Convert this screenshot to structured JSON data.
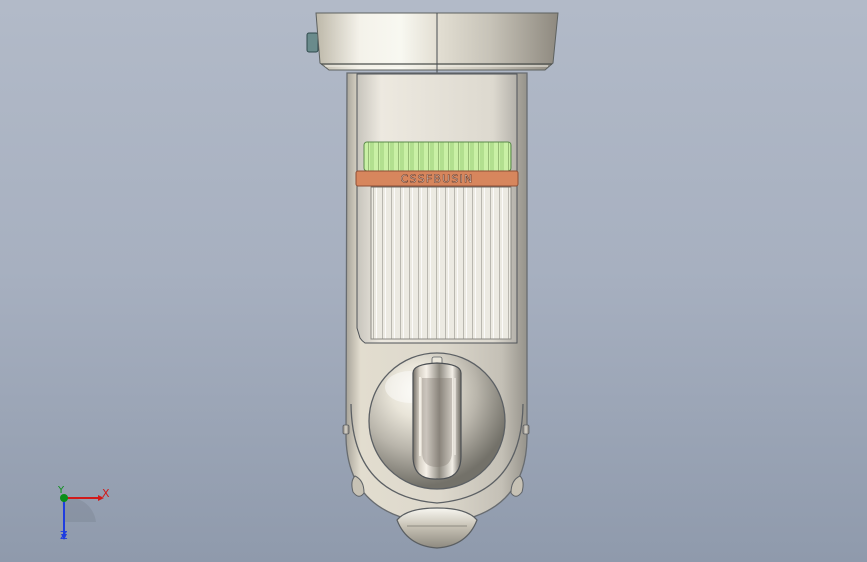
{
  "model": {
    "label_band_text": "CSSFBUSIN",
    "colors": {
      "background_top": "#b2bac8",
      "background_bottom": "#8f9aac",
      "body_fill": "#ddd8cc",
      "body_edge": "#656a70",
      "ring_band": "#d7865d",
      "grip_band": "#c9f0a5",
      "connector": "#6a8b8c"
    }
  },
  "triad": {
    "x_label": "X",
    "y_label": "Y",
    "z_label": "Z",
    "colors": {
      "x": "#d11a1a",
      "y": "#0b8f1a",
      "z": "#1f3de0"
    }
  }
}
